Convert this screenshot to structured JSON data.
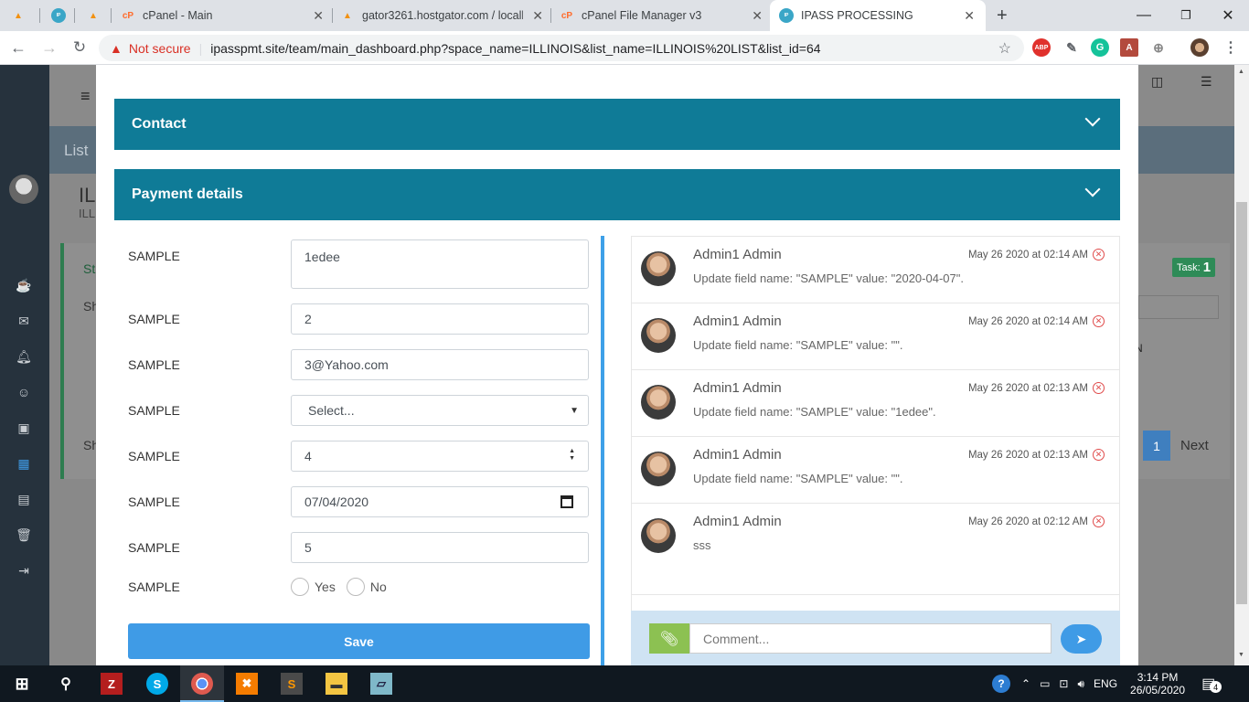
{
  "browser": {
    "tabs": [
      {
        "title": "",
        "icon": "PMA"
      },
      {
        "title": "",
        "icon": "IPASS"
      },
      {
        "title": "",
        "icon": "PMA"
      },
      {
        "title": "cPanel - Main",
        "icon": "cP"
      },
      {
        "title": "gator3261.hostgator.com / localh",
        "icon": "PMA"
      },
      {
        "title": "cPanel File Manager v3",
        "icon": "cP"
      },
      {
        "title": "IPASS PROCESSING",
        "icon": "IPASS"
      }
    ],
    "security_label": "Not secure",
    "url": "ipasspmt.site/team/main_dashboard.php?space_name=ILLINOIS&list_name=ILLINOIS%20LIST&list_id=64",
    "extensions": [
      "ABP"
    ]
  },
  "background": {
    "breadcrumb": "List",
    "page_title": "IL",
    "page_subtitle": "ILL",
    "status_abbrev": "St",
    "show_label": "Sh",
    "show_label_2": "Sh",
    "column_fragment": "N",
    "task_label": "Task:",
    "task_count": "1",
    "pagination": {
      "current": "1",
      "next": "Next"
    }
  },
  "modal": {
    "sections": [
      {
        "title": "Contact"
      },
      {
        "title": "Payment details"
      }
    ],
    "form": {
      "fields": [
        {
          "label": "SAMPLE",
          "value": "1edee",
          "type": "textarea"
        },
        {
          "label": "SAMPLE",
          "value": "2",
          "type": "text"
        },
        {
          "label": "SAMPLE",
          "value": "3@Yahoo.com",
          "type": "email"
        },
        {
          "label": "SAMPLE",
          "value": "Select...",
          "type": "select"
        },
        {
          "label": "SAMPLE",
          "value": "4",
          "type": "number"
        },
        {
          "label": "SAMPLE",
          "value": "07/04/2020",
          "type": "date"
        },
        {
          "label": "SAMPLE",
          "value": "5",
          "type": "text"
        },
        {
          "label": "SAMPLE",
          "type": "radio",
          "options": [
            "Yes",
            "No"
          ]
        }
      ],
      "save_label": "Save"
    },
    "activity": {
      "items": [
        {
          "author": "Admin1 Admin",
          "date": "May 26 2020 at 02:14 AM",
          "text": "Update field name: \"SAMPLE\" value: \"2020-04-07\"."
        },
        {
          "author": "Admin1 Admin",
          "date": "May 26 2020 at 02:14 AM",
          "text": "Update field name: \"SAMPLE\" value: \"\"."
        },
        {
          "author": "Admin1 Admin",
          "date": "May 26 2020 at 02:13 AM",
          "text": "Update field name: \"SAMPLE\" value: \"1edee\"."
        },
        {
          "author": "Admin1 Admin",
          "date": "May 26 2020 at 02:13 AM",
          "text": "Update field name: \"SAMPLE\" value: \"\"."
        },
        {
          "author": "Admin1 Admin",
          "date": "May 26 2020 at 02:12 AM",
          "text": "sss"
        }
      ],
      "comment_placeholder": "Comment..."
    }
  },
  "taskbar": {
    "language": "ENG",
    "time": "3:14 PM",
    "date": "26/05/2020",
    "notification_count": "4"
  },
  "colors": {
    "accordion": "#0f7b97",
    "save_button": "#3f9be6",
    "attach_button": "#8cc152",
    "task_badge": "#2e8b57",
    "pagination_active": "#3f7fbf"
  }
}
